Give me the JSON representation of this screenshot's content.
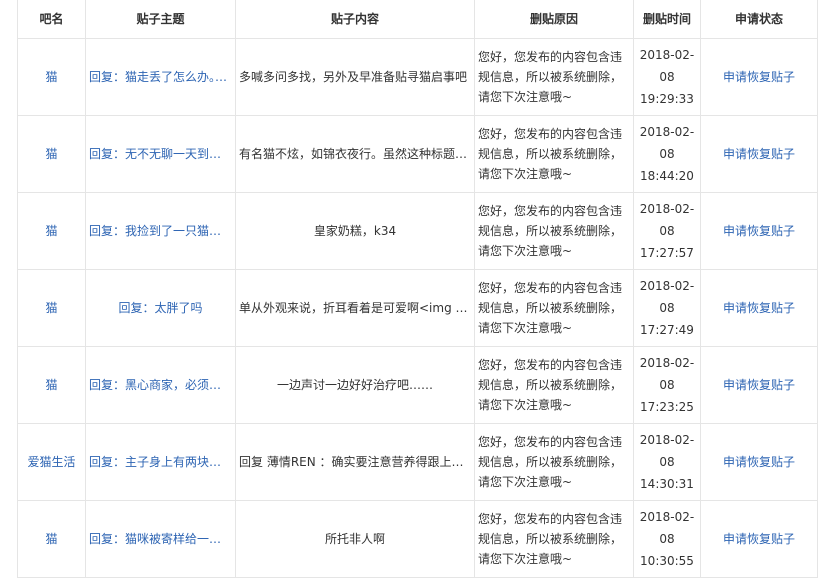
{
  "headers": {
    "forum": "吧名",
    "topic": "贴子主题",
    "content": "贴子内容",
    "reason": "删贴原因",
    "time": "删贴时间",
    "status": "申请状态"
  },
  "rows": [
    {
      "forum": "猫",
      "topic": "回复：猫走丢了怎么办。。。",
      "content": "多喊多问多找，另外及早准备贴寻猫启事吧",
      "reason": "您好，您发布的内容包含违规信息，所以被系统删除，请您下次注意哦~",
      "date": "2018-02-08",
      "clock": "19:29:33",
      "action": "申请恢复贴子"
    },
    {
      "forum": "猫",
      "topic": "回复：无不无聊一天到晚一直叫",
      "content": "有名猫不炫，如锦衣夜行。虽然这种标题很烦人",
      "reason": "您好，您发布的内容包含违规信息，所以被系统删除，请您下次注意哦~",
      "date": "2018-02-08",
      "clock": "18:44:20",
      "action": "申请恢复贴子"
    },
    {
      "forum": "猫",
      "topic": "回复：我捡到了一只猫，怎么办",
      "content": "皇家奶糕，k34",
      "reason": "您好，您发布的内容包含违规信息，所以被系统删除，请您下次注意哦~",
      "date": "2018-02-08",
      "clock": "17:27:57",
      "action": "申请恢复贴子"
    },
    {
      "forum": "猫",
      "topic": "回复：太胖了吗",
      "content": "单从外观来说，折耳看着是可爱啊<img class=",
      "reason": "您好，您发布的内容包含违规信息，所以被系统删除，请您下次注意哦~",
      "date": "2018-02-08",
      "clock": "17:27:49",
      "action": "申请恢复贴子"
    },
    {
      "forum": "猫",
      "topic": "回复：黑心商家，必须曝光",
      "content": "一边声讨一边好好治疗吧……",
      "reason": "您好，您发布的内容包含违规信息，所以被系统删除，请您下次注意哦~",
      "date": "2018-02-08",
      "clock": "17:23:25",
      "action": "申请恢复贴子"
    },
    {
      "forum": "爱猫生活",
      "topic": "回复：主子身上有两块地方秃了",
      "content": "回复 薄情REN ：确实要注意营养得跟上，多晒太阳",
      "reason": "您好，您发布的内容包含违规信息，所以被系统删除，请您下次注意哦~",
      "date": "2018-02-08",
      "clock": "14:30:31",
      "action": "申请恢复贴子"
    },
    {
      "forum": "猫",
      "topic": "回复：猫咪被寄样给一个陌生人",
      "content": "所托非人啊",
      "reason": "您好，您发布的内容包含违规信息，所以被系统删除，请您下次注意哦~",
      "date": "2018-02-08",
      "clock": "10:30:55",
      "action": "申请恢复贴子"
    }
  ]
}
